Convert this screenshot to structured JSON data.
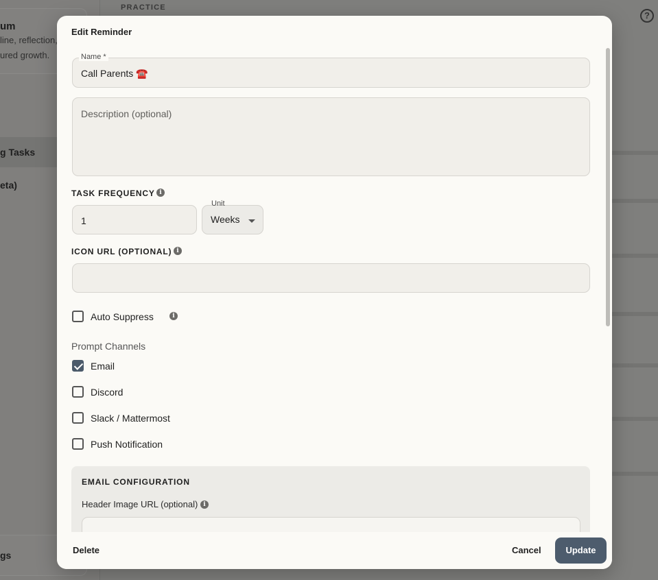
{
  "background": {
    "header_label": "PRACTICE",
    "card_title": "um",
    "card_line1": "line, reflection,",
    "card_line2": "ured growth.",
    "nav_active": "g Tasks",
    "nav_item": "eta)",
    "bottom_item": "gs",
    "help_icon": "?"
  },
  "modal": {
    "title": "Edit Reminder",
    "name_label": "Name *",
    "name_value": "Call Parents ☎️",
    "description_placeholder": "Description (optional)",
    "task_frequency_label": "TASK FREQUENCY",
    "frequency_value": "1",
    "unit_label": "Unit",
    "unit_value": "Weeks",
    "icon_url_label": "ICON URL (OPTIONAL)",
    "icon_url_value": "",
    "auto_suppress_label": "Auto Suppress",
    "auto_suppress_checked": false,
    "prompt_channels_label": "Prompt Channels",
    "channels": [
      {
        "label": "Email",
        "checked": true
      },
      {
        "label": "Discord",
        "checked": false
      },
      {
        "label": "Slack / Mattermost",
        "checked": false
      },
      {
        "label": "Push Notification",
        "checked": false
      }
    ],
    "email_config": {
      "title": "EMAIL CONFIGURATION",
      "header_image_label": "Header Image URL (optional)"
    },
    "info_glyph": "i"
  },
  "footer": {
    "delete_label": "Delete",
    "cancel_label": "Cancel",
    "update_label": "Update"
  },
  "colors": {
    "primary_button": "#4d5c6d",
    "modal_bg": "#fbfaf6",
    "overlay": "#7f7f7d"
  }
}
